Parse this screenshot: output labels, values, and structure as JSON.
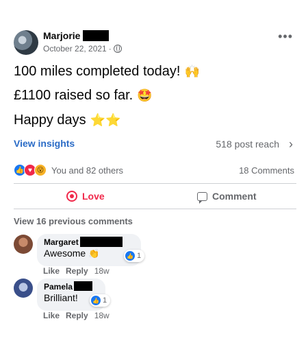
{
  "post": {
    "author": "Marjorie",
    "date": "October 22, 2021",
    "date_sep": "·",
    "more_glyph": "•••",
    "lines": [
      {
        "text": "100 miles completed today!",
        "emoji": "🙌"
      },
      {
        "text": "£1100 raised so far.",
        "emoji": "🤩"
      },
      {
        "text": "Happy days",
        "emoji": "⭐⭐"
      }
    ]
  },
  "insights": {
    "link": "View insights",
    "reach": "518 post reach",
    "chevron": "›"
  },
  "reactions": {
    "icons": [
      "like-reaction",
      "love-reaction",
      "wow-reaction"
    ],
    "like_glyph": "👍",
    "love_glyph": "♥",
    "wow_glyph": "😮",
    "summary": "You and 82 others",
    "comments_count": "18 Comments"
  },
  "actions": {
    "love": "Love",
    "comment": "Comment"
  },
  "comments_section": {
    "view_previous": "View 16 previous comments",
    "items": [
      {
        "name": "Margaret",
        "text": "Awesome",
        "emoji": "👏",
        "reaction_count": "1",
        "like": "Like",
        "reply": "Reply",
        "time": "18w"
      },
      {
        "name": "Pamela",
        "text": "Brilliant!",
        "emoji": "",
        "reaction_count": "1",
        "like": "Like",
        "reply": "Reply",
        "time": "18w"
      }
    ]
  },
  "colors": {
    "link_blue": "#2a6bc6",
    "love_red": "#f0284a",
    "muted": "#65676b",
    "bubble_bg": "#f0f2f5"
  }
}
